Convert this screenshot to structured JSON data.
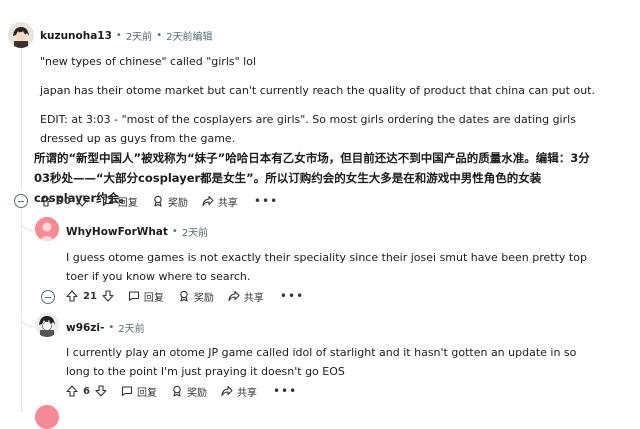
{
  "comment_main": {
    "username": "kuzunoha13",
    "time": "2天前",
    "edited": "2天前编辑",
    "paragraphs": [
      "\"new types of chinese\" called \"girls\" lol",
      "japan has their otome market but can't currently reach the quality of product that china can put out.",
      "EDIT: at 3:03 - \"most of the cosplayers are girls\". So most girls ordering the dates are dating girls dressed up as guys from the game."
    ],
    "translation": "所谓的“新型中国人”被戏称为“妹子”哈哈日本有乙女市场，但目前还达不到中国产品的质量水准。编辑：3分03秒处——“大部分cosplayer都是女生”。所以订购约会的女生大多是在和游戏中男性角色的女装cosplayer约会。",
    "votes": "90",
    "reply_label": "回复",
    "award_label": "奖励",
    "share_label": "共享",
    "more": "•••"
  },
  "reply1": {
    "username": "WhyHowForWhat",
    "time": "2天前",
    "paragraphs": [
      "I guess otome games is not exactly their speciality since their josei smut have been pretty top toer if you know where to search."
    ],
    "votes": "21",
    "reply_label": "回复",
    "award_label": "奖励",
    "share_label": "共享",
    "more": "•••"
  },
  "reply2": {
    "username": "w96zi-",
    "time": "2天前",
    "paragraphs": [
      "I currently play an otome JP game called idol of starlight and it hasn't gotten an update in so long to the point I'm just praying it doesn't go EOS"
    ],
    "votes": "6",
    "reply_label": "回复",
    "award_label": "奖励",
    "share_label": "共享",
    "more": "•••"
  },
  "colors": {
    "meta": "#576f76",
    "thread_line": "#e3e6e8",
    "avatar_pink": "#f26b7a"
  }
}
